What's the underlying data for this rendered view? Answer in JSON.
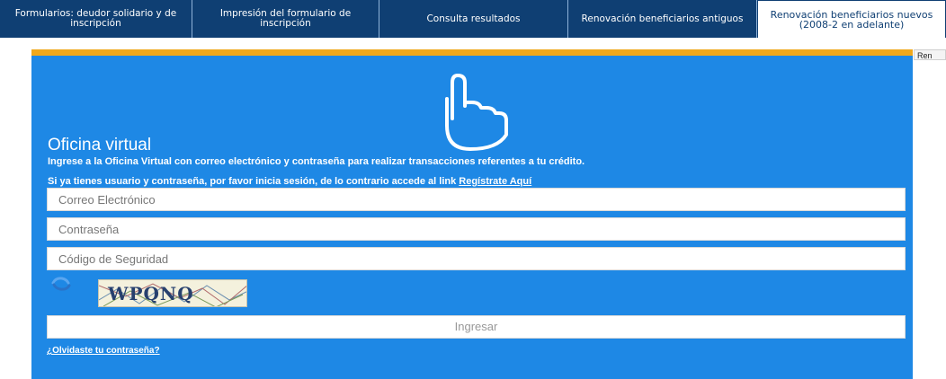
{
  "nav": {
    "tabs": [
      {
        "label": "Formularios: deudor solidario y de inscripción"
      },
      {
        "label": "Impresión del formulario de inscripción"
      },
      {
        "label": "Consulta resultados"
      },
      {
        "label": "Renovación beneficiarios antiguos"
      },
      {
        "label": "Renovación beneficiarios nuevos (2008-2 en adelante)"
      }
    ],
    "side_label": "Ren"
  },
  "login": {
    "icon": "pointing-hand-icon",
    "title": "Oficina virtual",
    "description": "Ingrese a la Oficina Virtual con correo electrónico y contraseña para realizar transacciones referentes a tu crédito.",
    "prompt": "Si ya tienes usuario y contraseña, por favor inicia sesión, de lo contrario accede al link",
    "register_link": "Regístrate Aquí",
    "email_placeholder": "Correo Electrónico",
    "password_placeholder": "Contraseña",
    "code_placeholder": "Código de Seguridad",
    "refresh_icon": "refresh-icon",
    "captcha_text": "WPQNQ",
    "submit_label": "Ingresar",
    "forgot_link": "¿Olvidaste tu contraseña?"
  },
  "colors": {
    "nav_background": "#0f3f73",
    "panel_background": "#1e88e5",
    "panel_top_border": "#f0a81b"
  }
}
